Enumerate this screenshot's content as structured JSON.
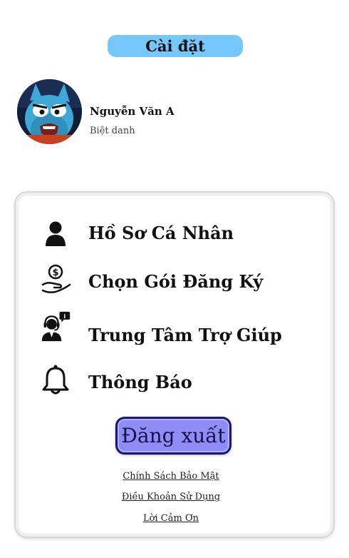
{
  "header": {
    "title": "Cài đặt"
  },
  "profile": {
    "name": "Nguyễn Văn A",
    "nickname": "Biệt danh",
    "avatar_icon": "cartoon-cat-avatar"
  },
  "menu": {
    "items": [
      {
        "label": "Hồ Sơ Cá Nhân",
        "icon": "person-icon"
      },
      {
        "label": "Chọn Gói Đăng Ký",
        "icon": "dollar-hand-icon"
      },
      {
        "label": "Trung Tâm Trợ Giúp",
        "icon": "support-agent-icon"
      },
      {
        "label": "Thông Báo",
        "icon": "bell-icon"
      }
    ]
  },
  "actions": {
    "logout_label": "Đăng xuất"
  },
  "footer": {
    "links": [
      "Chính Sách Bảo Mật",
      "Điều Khoản Sử Dụng",
      "Lời Cảm Ơn"
    ]
  },
  "colors": {
    "title_bg": "#76c7fb",
    "logout_bg": "#8f8cf5",
    "logout_border": "#1b1870"
  }
}
